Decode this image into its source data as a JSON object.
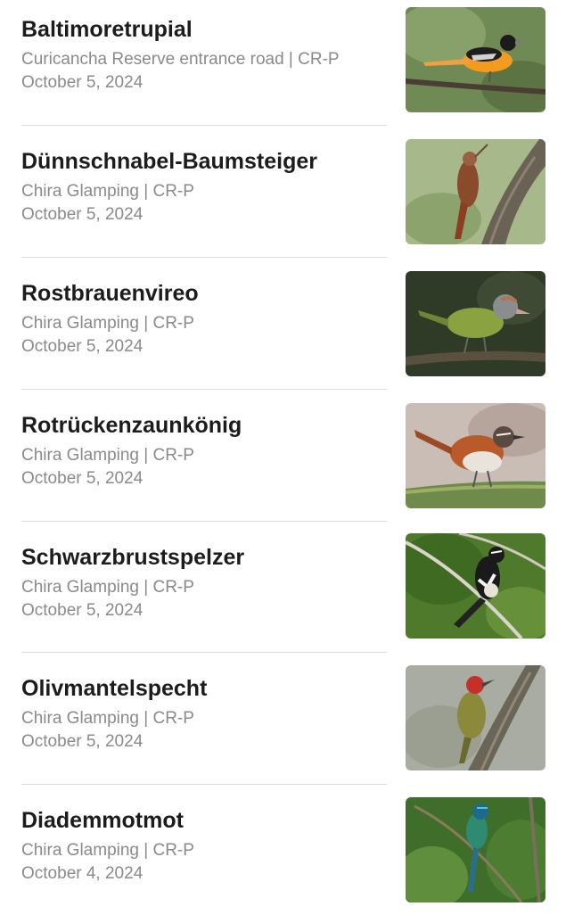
{
  "sightings": [
    {
      "species": "Baltimoretrupial",
      "location": "Curicancha Reserve entrance road | CR-P",
      "date": "October 5, 2024",
      "photo": "baltimore-oriole-photo"
    },
    {
      "species": "Dünnschnabel-Baumsteiger",
      "location": "Chira Glamping | CR-P",
      "date": "October 5, 2024",
      "photo": "woodcreeper-photo"
    },
    {
      "species": "Rostbrauenvireo",
      "location": "Chira Glamping | CR-P",
      "date": "October 5, 2024",
      "photo": "peppershrike-photo"
    },
    {
      "species": "Rotrückenzaunkönig",
      "location": "Chira Glamping | CR-P",
      "date": "October 5, 2024",
      "photo": "wren-photo"
    },
    {
      "species": "Schwarzbrustspelzer",
      "location": "Chira Glamping | CR-P",
      "date": "October 5, 2024",
      "photo": "black-and-white-bird-photo"
    },
    {
      "species": "Olivmantelspecht",
      "location": "Chira Glamping | CR-P",
      "date": "October 5, 2024",
      "photo": "woodpecker-photo"
    },
    {
      "species": "Diademmotmot",
      "location": "Chira Glamping | CR-P",
      "date": "October 4, 2024",
      "photo": "motmot-photo"
    }
  ]
}
